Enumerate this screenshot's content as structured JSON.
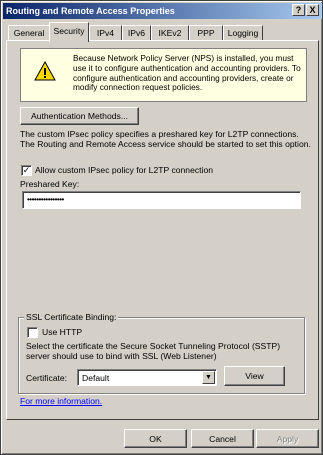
{
  "window": {
    "title": "Routing and Remote Access Properties",
    "help_label": "?",
    "close_label": "X"
  },
  "tabs": [
    {
      "label": "General",
      "active": false
    },
    {
      "label": "Security",
      "active": true
    },
    {
      "label": "IPv4",
      "active": false
    },
    {
      "label": "IPv6",
      "active": false
    },
    {
      "label": "IKEv2",
      "active": false
    },
    {
      "label": "PPP",
      "active": false
    },
    {
      "label": "Logging",
      "active": false
    }
  ],
  "info_box": {
    "icon": "warning-icon",
    "text": "Because Network Policy Server (NPS) is installed, you must use it to configure authentication and accounting providers. To configure authentication and accounting providers, create or modify connection request policies."
  },
  "auth_button_label": "Authentication Methods...",
  "ipsec_text": "The custom IPsec policy specifies a preshared key for L2TP connections. The Routing and Remote Access service should be started to set this option.",
  "allow_custom_ipsec": {
    "label": "Allow custom IPsec policy for L2TP connection",
    "checked": true
  },
  "preshared_key": {
    "label": "Preshared Key:",
    "value": "••••••••••••••••"
  },
  "ssl": {
    "legend": "SSL Certificate Binding:",
    "use_http": {
      "label": "Use HTTP",
      "checked": false
    },
    "description": "Select the certificate the Secure Socket Tunneling Protocol (SSTP) server should use to bind with SSL (Web Listener)",
    "certificate_label": "Certificate:",
    "certificate_value": "Default",
    "view_label": "View"
  },
  "more_info_link": "For more information.",
  "buttons": {
    "ok": "OK",
    "cancel": "Cancel",
    "apply": "Apply"
  }
}
